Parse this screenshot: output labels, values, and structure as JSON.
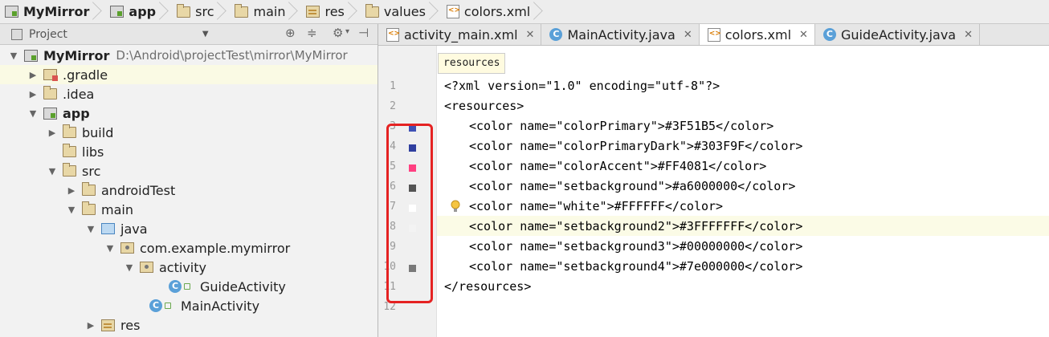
{
  "breadcrumb": [
    "MyMirror",
    "app",
    "src",
    "main",
    "res",
    "values",
    "colors.xml"
  ],
  "project_panel": {
    "title": "Project",
    "root_name": "MyMirror",
    "root_path": "D:\\Android\\projectTest\\mirror\\MyMirror",
    "items": [
      {
        "label": ".gradle"
      },
      {
        "label": ".idea"
      },
      {
        "label": "app"
      },
      {
        "label": "build"
      },
      {
        "label": "libs"
      },
      {
        "label": "src"
      },
      {
        "label": "androidTest"
      },
      {
        "label": "main"
      },
      {
        "label": "java"
      },
      {
        "label": "com.example.mymirror"
      },
      {
        "label": "activity"
      },
      {
        "label": "GuideActivity"
      },
      {
        "label": "MainActivity"
      },
      {
        "label": "res"
      }
    ]
  },
  "tabs": [
    {
      "label": "activity_main.xml"
    },
    {
      "label": "MainActivity.java"
    },
    {
      "label": "colors.xml"
    },
    {
      "label": "GuideActivity.java"
    }
  ],
  "editor": {
    "crumb_tooltip": "resources",
    "line_numbers": [
      "1",
      "2",
      "3",
      "4",
      "5",
      "6",
      "7",
      "8",
      "9",
      "10",
      "11",
      "12"
    ],
    "colors": {
      "colorPrimary": "#3F51B5",
      "colorPrimaryDark": "#303F9F",
      "colorAccent": "#FF4081",
      "setbackground": "#a6000000",
      "white": "#FFFFFF",
      "setbackground2": "#3FFFFFFF",
      "setbackground3": "#00000000",
      "setbackground4": "#7e000000"
    },
    "lines": {
      "l1": "<?xml version=\"1.0\" encoding=\"utf-8\"?>",
      "l2": "<resources>",
      "l3": "<color name=\"colorPrimary\">#3F51B5</color>",
      "l4": "<color name=\"colorPrimaryDark\">#303F9F</color>",
      "l5": "<color name=\"colorAccent\">#FF4081</color>",
      "l6": "<color name=\"setbackground\">#a6000000</color>",
      "l7": "<color name=\"white\">#FFFFFF</color>",
      "l8": "<color name=\"setbackground2\">#3FFFFFFF</color>",
      "l9": "<color name=\"setbackground3\">#00000000</color>",
      "l10": "<color name=\"setbackground4\">#7e000000</color>",
      "l11": "</resources>"
    }
  }
}
